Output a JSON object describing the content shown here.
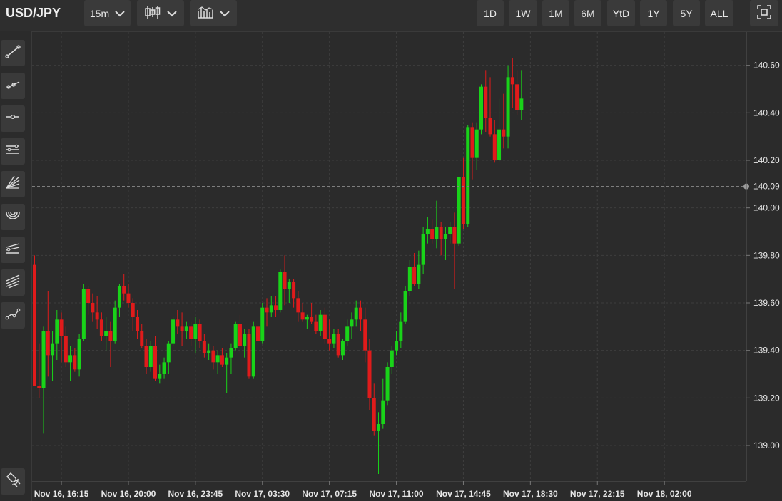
{
  "header": {
    "symbol": "USD/JPY",
    "interval": "15m",
    "chart_type_icon": "candlestick-icon",
    "indicator_icon": "indicators-icon",
    "ranges": [
      "1D",
      "1W",
      "1M",
      "6M",
      "YtD",
      "1Y",
      "5Y",
      "ALL"
    ],
    "fullscreen_icon": "fullscreen-icon"
  },
  "sidebar": {
    "tools": [
      "trend-line-icon",
      "ray-icon",
      "horizontal-line-icon",
      "parallel-channel-icon",
      "fan-icon",
      "arc-icon",
      "pitchfork-icon",
      "fib-channel-icon",
      "path-icon"
    ],
    "bottom_tool": "magnet-icon"
  },
  "colors": {
    "up": "#19d319",
    "down": "#e01b1b",
    "background": "#2b2b2b",
    "grid": "#3e3e3e",
    "last_price_line": "#8a8a8a"
  },
  "chart_data": {
    "type": "candlestick",
    "title": "",
    "ylim": [
      138.85,
      140.74
    ],
    "yticks": [
      139.0,
      139.2,
      139.4,
      139.6,
      139.8,
      140.0,
      140.2,
      140.4,
      140.6
    ],
    "ytick_labels": [
      "139.00",
      "139.20",
      "139.40",
      "139.60",
      "139.80",
      "140.00",
      "140.20",
      "140.40",
      "140.60"
    ],
    "last_price": 140.09,
    "last_price_label": "140.09",
    "xticks": [
      "Nov 16, 16:15",
      "Nov 16, 20:00",
      "Nov 16, 23:45",
      "Nov 17, 03:30",
      "Nov 17, 07:15",
      "Nov 17, 11:00",
      "Nov 17, 14:45",
      "Nov 17, 18:30",
      "Nov 17, 22:15",
      "Nov 18, 02:00"
    ],
    "xtick_index": [
      6,
      21,
      36,
      51,
      66,
      81,
      96,
      111,
      126,
      141
    ],
    "grid": true,
    "candles": [
      [
        139.76,
        139.8,
        139.25,
        139.25
      ],
      [
        139.25,
        139.43,
        139.2,
        139.24
      ],
      [
        139.24,
        139.5,
        139.05,
        139.48
      ],
      [
        139.48,
        139.65,
        139.29,
        139.38
      ],
      [
        139.38,
        139.48,
        139.27,
        139.43
      ],
      [
        139.43,
        139.57,
        139.36,
        139.53
      ],
      [
        139.53,
        139.56,
        139.35,
        139.46
      ],
      [
        139.46,
        139.5,
        139.33,
        139.35
      ],
      [
        139.35,
        139.42,
        139.27,
        139.38
      ],
      [
        139.38,
        139.41,
        139.31,
        139.32
      ],
      [
        139.32,
        139.47,
        139.29,
        139.45
      ],
      [
        139.45,
        139.68,
        139.44,
        139.66
      ],
      [
        139.66,
        139.67,
        139.55,
        139.6
      ],
      [
        139.6,
        139.64,
        139.52,
        139.56
      ],
      [
        139.56,
        139.63,
        139.49,
        139.53
      ],
      [
        139.53,
        139.56,
        139.44,
        139.46
      ],
      [
        139.46,
        139.54,
        139.4,
        139.48
      ],
      [
        139.48,
        139.52,
        139.33,
        139.44
      ],
      [
        139.44,
        139.61,
        139.43,
        139.58
      ],
      [
        139.58,
        139.68,
        139.54,
        139.67
      ],
      [
        139.67,
        139.72,
        139.61,
        139.64
      ],
      [
        139.64,
        139.68,
        139.58,
        139.6
      ],
      [
        139.6,
        139.62,
        139.48,
        139.54
      ],
      [
        139.54,
        139.57,
        139.45,
        139.48
      ],
      [
        139.48,
        139.51,
        139.41,
        139.42
      ],
      [
        139.42,
        139.45,
        139.3,
        139.33
      ],
      [
        139.33,
        139.44,
        139.31,
        139.42
      ],
      [
        139.42,
        139.46,
        139.27,
        139.28
      ],
      [
        139.28,
        139.34,
        139.26,
        139.3
      ],
      [
        139.3,
        139.37,
        139.28,
        139.35
      ],
      [
        139.35,
        139.44,
        139.3,
        139.43
      ],
      [
        139.43,
        139.54,
        139.42,
        139.53
      ],
      [
        139.53,
        139.57,
        139.47,
        139.5
      ],
      [
        139.5,
        139.56,
        139.42,
        139.48
      ],
      [
        139.48,
        139.52,
        139.45,
        139.5
      ],
      [
        139.5,
        139.52,
        139.42,
        139.45
      ],
      [
        139.45,
        139.54,
        139.39,
        139.51
      ],
      [
        139.51,
        139.53,
        139.41,
        139.44
      ],
      [
        139.44,
        139.47,
        139.37,
        139.39
      ],
      [
        139.39,
        139.43,
        139.36,
        139.4
      ],
      [
        139.4,
        139.42,
        139.32,
        139.35
      ],
      [
        139.35,
        139.4,
        139.3,
        139.38
      ],
      [
        139.38,
        139.41,
        139.33,
        139.34
      ],
      [
        139.34,
        139.39,
        139.22,
        139.37
      ],
      [
        139.37,
        139.43,
        139.3,
        139.41
      ],
      [
        139.41,
        139.52,
        139.4,
        139.51
      ],
      [
        139.51,
        139.55,
        139.39,
        139.42
      ],
      [
        139.42,
        139.49,
        139.37,
        139.47
      ],
      [
        139.47,
        139.49,
        139.28,
        139.29
      ],
      [
        139.29,
        139.52,
        139.28,
        139.5
      ],
      [
        139.5,
        139.56,
        139.42,
        139.44
      ],
      [
        139.44,
        139.6,
        139.43,
        139.58
      ],
      [
        139.58,
        139.62,
        139.5,
        139.56
      ],
      [
        139.56,
        139.63,
        139.54,
        139.59
      ],
      [
        139.59,
        139.63,
        139.54,
        139.57
      ],
      [
        139.57,
        139.74,
        139.56,
        139.73
      ],
      [
        139.73,
        139.8,
        139.59,
        139.66
      ],
      [
        139.66,
        139.7,
        139.6,
        139.69
      ],
      [
        139.69,
        139.7,
        139.58,
        139.62
      ],
      [
        139.62,
        139.65,
        139.52,
        139.56
      ],
      [
        139.56,
        139.6,
        139.52,
        139.53
      ],
      [
        139.53,
        139.55,
        139.49,
        139.54
      ],
      [
        139.54,
        139.6,
        139.51,
        139.52
      ],
      [
        139.52,
        139.55,
        139.47,
        139.48
      ],
      [
        139.48,
        139.57,
        139.46,
        139.55
      ],
      [
        139.55,
        139.58,
        139.43,
        139.45
      ],
      [
        139.45,
        139.53,
        139.4,
        139.43
      ],
      [
        139.43,
        139.49,
        139.41,
        139.47
      ],
      [
        139.47,
        139.49,
        139.37,
        139.38
      ],
      [
        139.38,
        139.45,
        139.36,
        139.44
      ],
      [
        139.44,
        139.53,
        139.42,
        139.5
      ],
      [
        139.5,
        139.56,
        139.45,
        139.53
      ],
      [
        139.53,
        139.61,
        139.5,
        139.58
      ],
      [
        139.58,
        139.61,
        139.48,
        139.53
      ],
      [
        139.53,
        139.58,
        139.35,
        139.4
      ],
      [
        139.4,
        139.45,
        139.15,
        139.2
      ],
      [
        139.2,
        139.26,
        139.04,
        139.06
      ],
      [
        139.06,
        139.14,
        138.88,
        139.09
      ],
      [
        139.09,
        139.28,
        139.07,
        139.19
      ],
      [
        139.19,
        139.35,
        139.17,
        139.33
      ],
      [
        139.33,
        139.42,
        139.3,
        139.4
      ],
      [
        139.4,
        139.48,
        139.38,
        139.44
      ],
      [
        139.44,
        139.56,
        139.41,
        139.52
      ],
      [
        139.52,
        139.67,
        139.51,
        139.65
      ],
      [
        139.65,
        139.78,
        139.63,
        139.75
      ],
      [
        139.75,
        139.81,
        139.67,
        139.68
      ],
      [
        139.68,
        139.82,
        139.66,
        139.76
      ],
      [
        139.76,
        139.92,
        139.72,
        139.89
      ],
      [
        139.89,
        139.96,
        139.85,
        139.91
      ],
      [
        139.91,
        139.95,
        139.85,
        139.87
      ],
      [
        139.87,
        140.03,
        139.83,
        139.92
      ],
      [
        139.92,
        139.94,
        139.8,
        139.87
      ],
      [
        139.87,
        139.92,
        139.78,
        139.89
      ],
      [
        139.89,
        139.94,
        139.85,
        139.92
      ],
      [
        139.92,
        139.98,
        139.66,
        139.85
      ],
      [
        139.85,
        140.12,
        139.84,
        140.13
      ],
      [
        140.13,
        140.21,
        139.91,
        139.93
      ],
      [
        139.93,
        140.35,
        139.92,
        140.34
      ],
      [
        140.34,
        140.36,
        140.12,
        140.21
      ],
      [
        140.21,
        140.36,
        140.16,
        140.33
      ],
      [
        140.33,
        140.52,
        140.31,
        140.51
      ],
      [
        140.51,
        140.58,
        140.32,
        140.38
      ],
      [
        140.38,
        140.55,
        140.3,
        140.31
      ],
      [
        140.31,
        140.37,
        140.19,
        140.2
      ],
      [
        140.2,
        140.46,
        140.19,
        140.33
      ],
      [
        140.33,
        140.48,
        140.25,
        140.3
      ],
      [
        140.3,
        140.6,
        140.25,
        140.55
      ],
      [
        140.55,
        140.63,
        140.42,
        140.52
      ],
      [
        140.52,
        140.58,
        140.39,
        140.41
      ],
      [
        140.41,
        140.58,
        140.37,
        140.46
      ]
    ]
  }
}
